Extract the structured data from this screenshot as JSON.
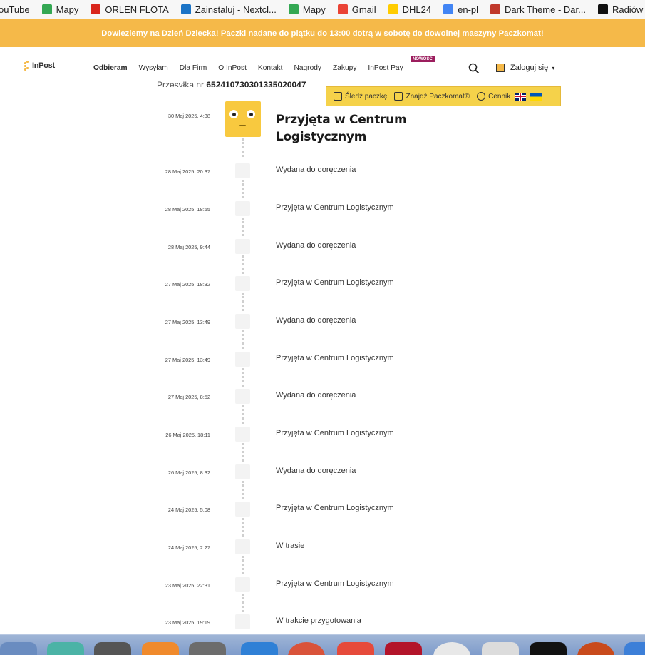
{
  "bookmarks": [
    {
      "label": "ouTube",
      "icon": "youtube-icon",
      "color": "#ff0000"
    },
    {
      "label": "Mapy",
      "icon": "maps-icon",
      "color": "#34a853"
    },
    {
      "label": "ORLEN FLOTA",
      "icon": "orlen-icon",
      "color": "#d9261c"
    },
    {
      "label": "Zainstaluj - Nextcl...",
      "icon": "nextcloud-icon",
      "color": "#1c74c6"
    },
    {
      "label": "Mapy",
      "icon": "maps-icon",
      "color": "#34a853"
    },
    {
      "label": "Gmail",
      "icon": "gmail-icon",
      "color": "#ea4335"
    },
    {
      "label": "DHL24",
      "icon": "dhl-icon",
      "color": "#ffcc00"
    },
    {
      "label": "en-pl",
      "icon": "translate-icon",
      "color": "#4285f4"
    },
    {
      "label": "Dark Theme - Dar...",
      "icon": "dark-theme-icon",
      "color": "#c0392b"
    },
    {
      "label": "Radiów",
      "icon": "radio-icon",
      "color": "#111111"
    }
  ],
  "promo": {
    "text": "Dowieziemy na Dzień Dziecka! Paczki nadane do piątku do 13:00 dotrą w sobotę do dowolnej maszyny Paczkomat!"
  },
  "nav": {
    "logo": "InPost",
    "menu": [
      "Odbieram",
      "Wysyłam",
      "Dla Firm",
      "O InPost",
      "Kontakt",
      "Nagrody",
      "Zakupy",
      "InPost Pay"
    ],
    "badge": "NOWOŚĆ",
    "login": "Zaloguj się",
    "login_caret": "▾",
    "accent": "#f5b949"
  },
  "tools": {
    "track": "Śledź paczkę",
    "find": "Znajdź Paczkomat®",
    "price": "Cennik"
  },
  "parcel": {
    "prefix": "Przesyłka nr",
    "number": "652410730301335020047"
  },
  "timeline": [
    {
      "date": "30 Maj 2025, 4:38",
      "status": "Przyjęta w Centrum Logistycznym"
    },
    {
      "date": "28 Maj 2025, 20:37",
      "status": "Wydana do doręczenia"
    },
    {
      "date": "28 Maj 2025, 18:55",
      "status": "Przyjęta w Centrum Logistycznym"
    },
    {
      "date": "28 Maj 2025, 9:44",
      "status": "Wydana do doręczenia"
    },
    {
      "date": "27 Maj 2025, 18:32",
      "status": "Przyjęta w Centrum Logistycznym"
    },
    {
      "date": "27 Maj 2025, 13:49",
      "status": "Wydana do doręczenia"
    },
    {
      "date": "27 Maj 2025, 13:49",
      "status": "Przyjęta w Centrum Logistycznym"
    },
    {
      "date": "27 Maj 2025, 8:52",
      "status": "Wydana do doręczenia"
    },
    {
      "date": "26 Maj 2025, 18:11",
      "status": "Przyjęta w Centrum Logistycznym"
    },
    {
      "date": "26 Maj 2025, 8:32",
      "status": "Wydana do doręczenia"
    },
    {
      "date": "24 Maj 2025, 5:08",
      "status": "Przyjęta w Centrum Logistycznym"
    },
    {
      "date": "24 Maj 2025, 2:27",
      "status": "W trasie"
    },
    {
      "date": "23 Maj 2025, 22:31",
      "status": "Przyjęta w Centrum Logistycznym"
    },
    {
      "date": "23 Maj 2025, 19:19",
      "status": "W trakcie przygotowania"
    }
  ]
}
